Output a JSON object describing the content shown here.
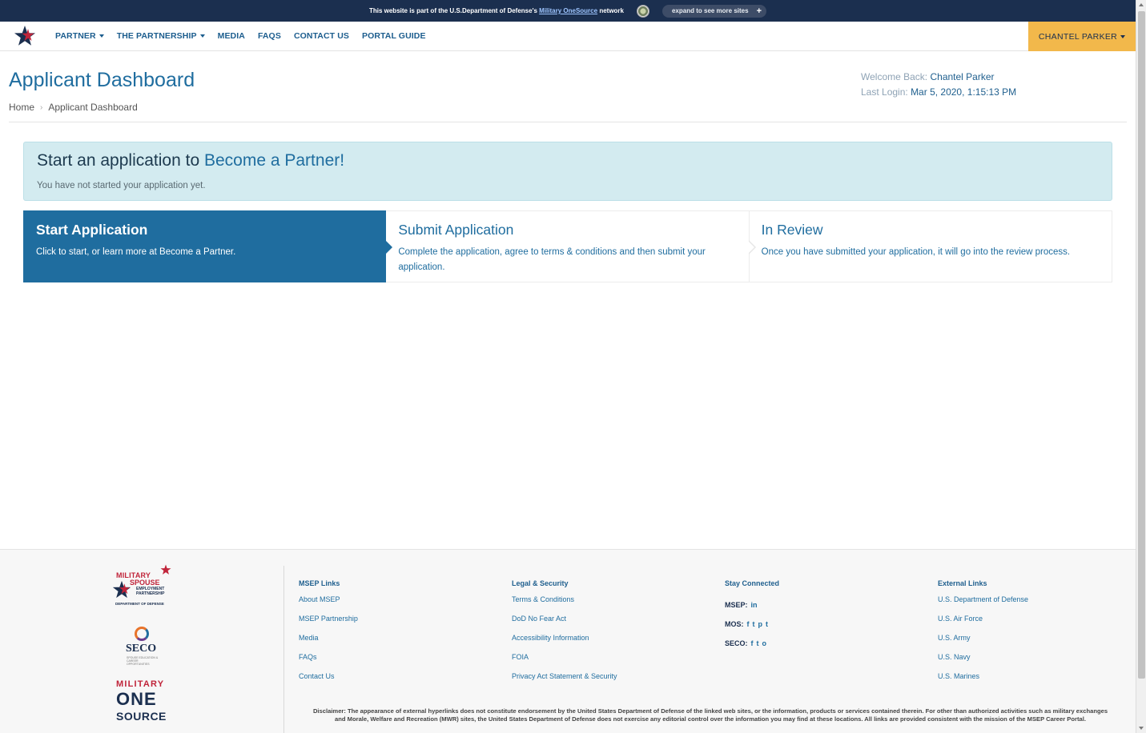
{
  "dod_banner": {
    "text_before": "This website is part of the U.S.Department of Defense's",
    "link": "Military OneSource",
    "text_after": "network",
    "expand_label": "expand to see more sites",
    "expand_icon": "+"
  },
  "nav": {
    "items": [
      {
        "label": "PARTNER",
        "dropdown": true
      },
      {
        "label": "THE PARTNERSHIP",
        "dropdown": true
      },
      {
        "label": "MEDIA",
        "dropdown": false
      },
      {
        "label": "FAQS",
        "dropdown": false
      },
      {
        "label": "CONTACT US",
        "dropdown": false
      },
      {
        "label": "PORTAL GUIDE",
        "dropdown": false
      }
    ],
    "user": "CHANTEL PARKER"
  },
  "header": {
    "title": "Applicant Dashboard",
    "breadcrumb": [
      "Home",
      "Applicant Dashboard"
    ],
    "welcome_label": "Welcome Back:",
    "welcome_name": "Chantel Parker",
    "last_login_label": "Last Login:",
    "last_login_value": "Mar 5, 2020, 1:15:13 PM"
  },
  "alert": {
    "title_start": "Start an application to",
    "title_accent": "Become a Partner!",
    "subtitle": "You have not started your application yet."
  },
  "steps": [
    {
      "title": "Start Application",
      "desc": "Click to start, or learn more at Become a Partner.",
      "active": true
    },
    {
      "title": "Submit Application",
      "desc": "Complete the application, agree to terms & conditions and then submit your application.",
      "active": false
    },
    {
      "title": "In Review",
      "desc": "Once you have submitted your application, it will go into the review process.",
      "active": false
    }
  ],
  "footer": {
    "logos": {
      "msep": {
        "line1": "MILITARY",
        "line2": "SPOUSE",
        "line3a": "EMPLOYMENT",
        "line3b": "PARTNERSHIP",
        "line4": "DEPARTMENT OF DEFENSE"
      },
      "seco": {
        "name": "SECO",
        "small": "SPOUSE EDUCATION & CAREER OPPORTUNITIES"
      },
      "mos": {
        "line1": "MILITARY",
        "line2": "ONE",
        "line3": "SOURCE"
      }
    },
    "msep_links": {
      "heading": "MSEP Links",
      "items": [
        "About MSEP",
        "MSEP Partnership",
        "Media",
        "FAQs",
        "Contact Us"
      ]
    },
    "legal_links": {
      "heading": "Legal & Security",
      "items": [
        "Terms & Conditions",
        "DoD No Fear Act",
        "Accessibility Information",
        "FOIA",
        "Privacy Act Statement & Security"
      ]
    },
    "stay_connected": {
      "heading": "Stay Connected",
      "rows": [
        {
          "label": "MSEP:",
          "icons": [
            "in"
          ]
        },
        {
          "label": "MOS:",
          "icons": [
            "f",
            "t",
            "p",
            "t"
          ]
        },
        {
          "label": "SECO:",
          "icons": [
            "f",
            "t",
            "o"
          ]
        }
      ]
    },
    "external_links": {
      "heading": "External Links",
      "items": [
        "U.S. Department of Defense",
        "U.S. Air Force",
        "U.S. Army",
        "U.S. Navy",
        "U.S. Marines"
      ]
    },
    "disclaimer_label": "Disclaimer:",
    "disclaimer": "The appearance of external hyperlinks does not constitute endorsement by the United States Department of Defense of the linked web sites, or the information, products or services contained therein. For other than authorized activities such as military exchanges and Morale, Welfare and Recreation (MWR) sites, the United States Department of Defense does not exercise any editorial control over the information you may find at these locations. All links are provided consistent with the mission of the MSEP Career Portal."
  }
}
